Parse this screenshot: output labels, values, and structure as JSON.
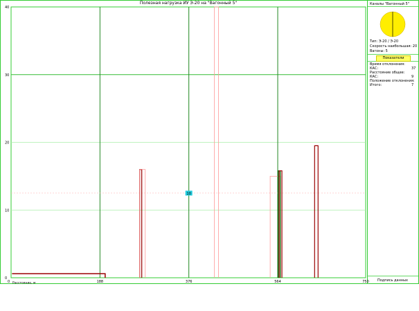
{
  "chart_data": {
    "type": "bar",
    "title": "Полезная нагрузка ИУ Э-20 на \"Вагонный 5\"",
    "xlabel": "Расстояние, м",
    "ylabel": "",
    "xlim": [
      0,
      750
    ],
    "ylim": [
      0,
      40
    ],
    "x_ticks": [
      0,
      188,
      376,
      564,
      750
    ],
    "x_tick_labels": [
      "0",
      "188",
      "376",
      "564",
      "750"
    ],
    "y_ticks": [
      0,
      10,
      20,
      30,
      40
    ],
    "y_tick_labels": [
      "0",
      "10",
      "20",
      "30",
      "40"
    ],
    "major_x_lines": [
      188,
      376,
      564
    ],
    "major_y_lines": [
      30
    ],
    "minor_y_lines": [
      10,
      20
    ],
    "reference_lines": [
      12.5
    ],
    "marker": {
      "x": 376,
      "y": 12.5,
      "label": "10"
    },
    "series": [
      {
        "kind": "step",
        "color": "#990000",
        "points": [
          [
            2,
            0.6
          ],
          [
            199,
            0.6
          ],
          [
            199,
            0
          ]
        ]
      },
      {
        "kind": "bar",
        "color": "#990000",
        "x": 272,
        "y": 16,
        "width": 3
      },
      {
        "kind": "bar",
        "color": "#ff9999",
        "x": 272,
        "y": 16,
        "width": 8
      },
      {
        "kind": "bar",
        "color": "#ff9999",
        "x": 430,
        "y": 40,
        "width": 6
      },
      {
        "kind": "bar",
        "color": "#ff9999",
        "x": 548,
        "y": 15,
        "width": 15
      },
      {
        "kind": "bar",
        "color": "#006600",
        "x": 565,
        "y": 15.8,
        "width": 3
      },
      {
        "kind": "bar",
        "color": "#990000",
        "x": 567,
        "y": 15.8,
        "width": 4
      },
      {
        "kind": "bar",
        "color": "#990000",
        "x": 642,
        "y": 19.5,
        "width": 5
      }
    ]
  },
  "side_panel": {
    "header": "Каналы \"Вагонный 5\"",
    "sun_color": "#ffee00",
    "info_lines": [
      "Тип: Э-20 / Э-20",
      "Скорость наибольшая: 20",
      "Вагоны: 5"
    ],
    "legend_button": "Показатели",
    "stats": [
      {
        "label": "Время отклонения:",
        "value": ""
      },
      {
        "label": "КАС:",
        "value": "37"
      },
      {
        "label": "Расстояние общее:",
        "value": ""
      },
      {
        "label": "КАС:",
        "value": "9"
      },
      {
        "label": "Положение отклонения:",
        "value": ""
      },
      {
        "label": "Итого:",
        "value": "7"
      }
    ],
    "footer": "Подпись данных"
  }
}
